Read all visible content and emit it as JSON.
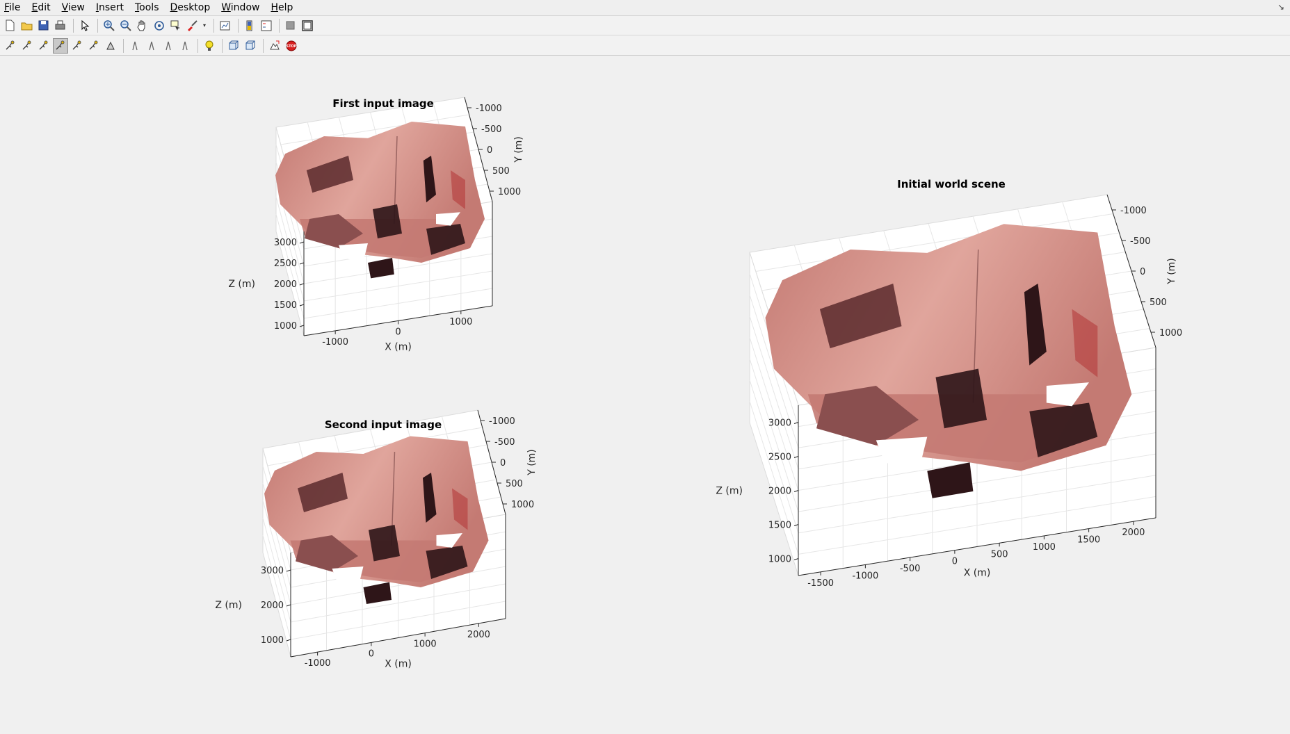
{
  "menu": {
    "items": [
      {
        "mnemonic": "F",
        "rest": "ile"
      },
      {
        "mnemonic": "E",
        "rest": "dit"
      },
      {
        "mnemonic": "V",
        "rest": "iew"
      },
      {
        "mnemonic": "I",
        "rest": "nsert"
      },
      {
        "mnemonic": "T",
        "rest": "ools"
      },
      {
        "mnemonic": "D",
        "rest": "esktop"
      },
      {
        "mnemonic": "W",
        "rest": "indow"
      },
      {
        "mnemonic": "H",
        "rest": "elp"
      }
    ],
    "undock_icon": "↘"
  },
  "toolbar1_icons": [
    "new-figure-icon",
    "open-file-icon",
    "save-icon",
    "print-icon",
    "pointer-icon",
    "zoom-in-icon",
    "zoom-out-icon",
    "pan-icon",
    "rotate-3d-icon",
    "data-cursor-icon",
    "brush-icon",
    "link-plot-icon",
    "colorbar-icon",
    "legend-icon",
    "hide-plot-tools-icon",
    "show-plot-tools-icon"
  ],
  "toolbar2_icons": [
    "orbit-camera-icon",
    "orbit-light-icon",
    "pan-tilt-icon",
    "move-camera-icon",
    "move-forward-icon",
    "zoom-camera-icon",
    "roll-camera-icon",
    "x-principal-axis-icon",
    "y-principal-axis-icon",
    "z-principal-axis-icon",
    "no-principal-axis-icon",
    "light-icon",
    "orthographic-icon",
    "perspective-icon",
    "reset-camera-icon",
    "stop-camera-icon"
  ],
  "colors": {
    "wall": "#c47a73",
    "wall_light": "#e0a59c",
    "shadow": "#5a2a2d",
    "dark": "#2e1518",
    "axes_bg": "#ffffff",
    "grid": "#e6e6e6",
    "text": "#262626"
  },
  "plots": {
    "first": {
      "title": "First input image",
      "xlabel": "X (m)",
      "ylabel": "Y (m)",
      "zlabel": "Z (m)",
      "xticks": [
        "-1000",
        "0",
        "1000"
      ],
      "yticks": [
        "-1000",
        "-500",
        "0",
        "500",
        "1000"
      ],
      "zticks": [
        "3000",
        "2500",
        "2000",
        "1500",
        "1000"
      ]
    },
    "second": {
      "title": "Second input image",
      "xlabel": "X (m)",
      "ylabel": "Y (m)",
      "zlabel": "Z (m)",
      "xticks": [
        "-1000",
        "0",
        "1000",
        "2000"
      ],
      "yticks": [
        "-1000",
        "-500",
        "0",
        "500",
        "1000"
      ],
      "zticks": [
        "3000",
        "2000",
        "1000"
      ]
    },
    "world": {
      "title": "Initial world scene",
      "xlabel": "X (m)",
      "ylabel": "Y (m)",
      "zlabel": "Z (m)",
      "xticks": [
        "-1500",
        "-1000",
        "-500",
        "0",
        "500",
        "1000",
        "1500",
        "2000"
      ],
      "yticks": [
        "-1000",
        "-500",
        "0",
        "500",
        "1000"
      ],
      "zticks": [
        "3000",
        "2500",
        "2000",
        "1500",
        "1000"
      ]
    }
  }
}
